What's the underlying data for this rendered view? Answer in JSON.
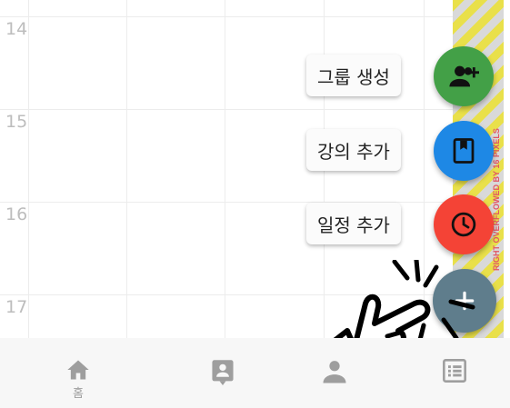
{
  "calendar": {
    "hours": [
      "14",
      "15",
      "16",
      "17"
    ]
  },
  "speed_dial": {
    "items": [
      {
        "label": "그룹 생성",
        "icon": "group-add-icon",
        "color": "#43a047"
      },
      {
        "label": "강의 추가",
        "icon": "book-icon",
        "color": "#1e88e5"
      },
      {
        "label": "일정 추가",
        "icon": "clock-icon",
        "color": "#f44336"
      }
    ],
    "main_button": {
      "icon": "close-icon",
      "color": "#5f7d8c"
    }
  },
  "debug": {
    "overflow_text": "RIGHT OVERFLOWED BY 16 PIXELS"
  },
  "bottom_nav": {
    "items": [
      {
        "label": "홈",
        "icon": "home-icon"
      },
      {
        "label": "",
        "icon": "contact-card-icon"
      },
      {
        "label": "",
        "icon": "person-icon"
      },
      {
        "label": "",
        "icon": "list-icon"
      }
    ]
  }
}
